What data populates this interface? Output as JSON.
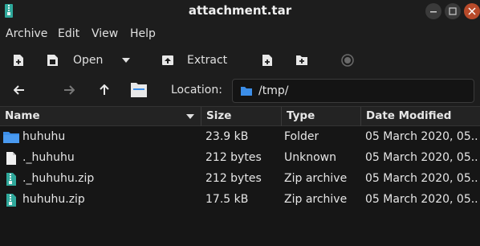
{
  "window": {
    "title": "attachment.tar"
  },
  "menu": [
    "Archive",
    "Edit",
    "View",
    "Help"
  ],
  "toolbar": {
    "open_label": "Open",
    "extract_label": "Extract"
  },
  "location": {
    "label": "Location:",
    "value": "/tmp/"
  },
  "columns": {
    "name": "Name",
    "size": "Size",
    "type": "Type",
    "date": "Date Modified"
  },
  "files": [
    {
      "name": "huhuhu",
      "size": "23.9 kB",
      "type": "Folder",
      "date": "05 March 2020, 05...",
      "icon": "folder-icon"
    },
    {
      "name": "._huhuhu",
      "size": "212 bytes",
      "type": "Unknown",
      "date": "05 March 2020, 05...",
      "icon": "file-icon"
    },
    {
      "name": "._huhuhu.zip",
      "size": "212 bytes",
      "type": "Zip archive",
      "date": "05 March 2020, 05...",
      "icon": "zip-icon"
    },
    {
      "name": "huhuhu.zip",
      "size": "17.5 kB",
      "type": "Zip archive",
      "date": "05 March 2020, 05...",
      "icon": "zip-icon"
    }
  ],
  "colors": {
    "accent": "#3c8ee8",
    "zip": "#2fa89b",
    "close": "#b84a2a"
  }
}
